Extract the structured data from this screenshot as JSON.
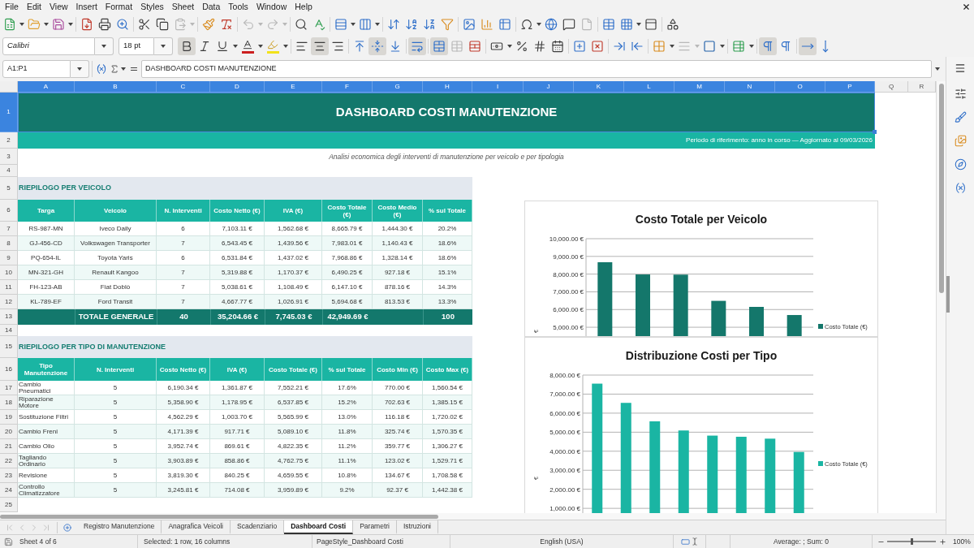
{
  "menu": [
    "File",
    "Edit",
    "View",
    "Insert",
    "Format",
    "Styles",
    "Sheet",
    "Data",
    "Tools",
    "Window",
    "Help"
  ],
  "standard_toolbar": [
    {
      "kind": "new",
      "disabled": false
    },
    {
      "kind": "open",
      "disabled": false
    },
    {
      "kind": "save",
      "disabled": false
    },
    {
      "kind": "export-pdf",
      "disabled": false
    },
    {
      "kind": "print",
      "disabled": false
    },
    {
      "kind": "print-preview",
      "disabled": false
    },
    {
      "kind": "cut",
      "disabled": false
    },
    {
      "kind": "copy",
      "disabled": false
    },
    {
      "kind": "paste",
      "disabled": true
    },
    {
      "kind": "clone-formatting",
      "disabled": false
    },
    {
      "kind": "clear-formatting",
      "disabled": false
    },
    {
      "kind": "undo",
      "disabled": true
    },
    {
      "kind": "redo",
      "disabled": true
    },
    {
      "kind": "find-replace",
      "disabled": false
    },
    {
      "kind": "spelling",
      "disabled": false
    },
    {
      "kind": "row",
      "disabled": false
    },
    {
      "kind": "column",
      "disabled": false
    },
    {
      "kind": "sort",
      "disabled": false
    },
    {
      "kind": "sort-ascending",
      "disabled": false
    },
    {
      "kind": "sort-descending",
      "disabled": false
    },
    {
      "kind": "autofilter",
      "disabled": false
    },
    {
      "kind": "image",
      "disabled": false
    },
    {
      "kind": "chart",
      "disabled": false
    },
    {
      "kind": "pivot-table",
      "disabled": false
    },
    {
      "kind": "special-character",
      "disabled": false
    },
    {
      "kind": "hyperlink",
      "disabled": false
    },
    {
      "kind": "comment",
      "disabled": false
    },
    {
      "kind": "header-footer",
      "disabled": true
    },
    {
      "kind": "print-area",
      "disabled": false
    },
    {
      "kind": "freeze",
      "disabled": false
    },
    {
      "kind": "split-window",
      "disabled": false
    },
    {
      "kind": "draw-functions",
      "disabled": false
    }
  ],
  "formatting_toolbar": {
    "font_name": "Calibri",
    "font_size": "18 pt",
    "buttons": [
      {
        "kind": "bold",
        "selected": true,
        "disabled": false
      },
      {
        "kind": "italic",
        "selected": false,
        "disabled": false
      },
      {
        "kind": "underline",
        "selected": false,
        "disabled": false
      },
      {
        "kind": "font-color",
        "selected": false,
        "disabled": false
      },
      {
        "kind": "highlight",
        "selected": false,
        "disabled": false
      },
      {
        "kind": "align-left",
        "selected": false,
        "disabled": false
      },
      {
        "kind": "align-center",
        "selected": true,
        "disabled": false
      },
      {
        "kind": "align-right",
        "selected": false,
        "disabled": false
      },
      {
        "kind": "align-top",
        "selected": false,
        "disabled": false
      },
      {
        "kind": "align-middle",
        "selected": true,
        "disabled": false
      },
      {
        "kind": "align-bottom",
        "selected": false,
        "disabled": false
      },
      {
        "kind": "wrap-text",
        "selected": true,
        "disabled": false
      },
      {
        "kind": "merge-center",
        "selected": true,
        "disabled": false
      },
      {
        "kind": "merge",
        "selected": false,
        "disabled": true
      },
      {
        "kind": "unmerge",
        "selected": false,
        "disabled": false
      },
      {
        "kind": "currency",
        "selected": false,
        "disabled": false
      },
      {
        "kind": "percent",
        "selected": false,
        "disabled": false
      },
      {
        "kind": "number",
        "selected": false,
        "disabled": false
      },
      {
        "kind": "date",
        "selected": false,
        "disabled": false
      },
      {
        "kind": "add-decimal",
        "selected": false,
        "disabled": false
      },
      {
        "kind": "delete-decimal",
        "selected": false,
        "disabled": false
      },
      {
        "kind": "indent",
        "selected": false,
        "disabled": false
      },
      {
        "kind": "outdent",
        "selected": false,
        "disabled": false
      },
      {
        "kind": "borders",
        "selected": false,
        "disabled": false
      },
      {
        "kind": "border-style",
        "selected": false,
        "disabled": true
      },
      {
        "kind": "border-color",
        "selected": false,
        "disabled": false
      },
      {
        "kind": "conditional",
        "selected": false,
        "disabled": false
      },
      {
        "kind": "ltr",
        "selected": true,
        "disabled": false
      },
      {
        "kind": "rtl",
        "selected": false,
        "disabled": false
      },
      {
        "kind": "text-ltr",
        "selected": true,
        "disabled": false
      },
      {
        "kind": "text-ttb",
        "selected": false,
        "disabled": false
      }
    ]
  },
  "formula_bar": {
    "name_box": "A1:P1",
    "content": "DASHBOARD COSTI MANUTENZIONE"
  },
  "sheet": {
    "columns": [
      {
        "label": "A",
        "selected": true
      },
      {
        "label": "B",
        "selected": true
      },
      {
        "label": "C",
        "selected": true
      },
      {
        "label": "D",
        "selected": true
      },
      {
        "label": "E",
        "selected": true
      },
      {
        "label": "F",
        "selected": true
      },
      {
        "label": "G",
        "selected": true
      },
      {
        "label": "H",
        "selected": true
      },
      {
        "label": "I",
        "selected": true
      },
      {
        "label": "J",
        "selected": true
      },
      {
        "label": "K",
        "selected": true
      },
      {
        "label": "L",
        "selected": true
      },
      {
        "label": "M",
        "selected": true
      },
      {
        "label": "N",
        "selected": true
      },
      {
        "label": "O",
        "selected": true
      },
      {
        "label": "P",
        "selected": true
      },
      {
        "label": "Q",
        "selected": false
      },
      {
        "label": "R",
        "selected": false
      }
    ],
    "rows": [
      {
        "label": "1",
        "selected": true
      },
      {
        "label": "2",
        "selected": false
      },
      {
        "label": "3",
        "selected": false
      },
      {
        "label": "4",
        "selected": false
      },
      {
        "label": "5",
        "selected": false
      },
      {
        "label": "6",
        "selected": false
      },
      {
        "label": "7",
        "selected": false
      },
      {
        "label": "8",
        "selected": false
      },
      {
        "label": "9",
        "selected": false
      },
      {
        "label": "10",
        "selected": false
      },
      {
        "label": "11",
        "selected": false
      },
      {
        "label": "12",
        "selected": false
      },
      {
        "label": "13",
        "selected": false
      },
      {
        "label": "14",
        "selected": false
      },
      {
        "label": "15",
        "selected": false
      },
      {
        "label": "16",
        "selected": false
      },
      {
        "label": "17",
        "selected": false
      },
      {
        "label": "18",
        "selected": false
      },
      {
        "label": "19",
        "selected": false
      },
      {
        "label": "20",
        "selected": false
      },
      {
        "label": "21",
        "selected": false
      },
      {
        "label": "22",
        "selected": false
      },
      {
        "label": "23",
        "selected": false
      },
      {
        "label": "24",
        "selected": false
      },
      {
        "label": "25",
        "selected": false
      }
    ],
    "title": "DASHBOARD COSTI MANUTENZIONE",
    "period": "Periodo di riferimento: anno in corso — Aggiornato al 09/03/2026",
    "subtitle": "Analisi economica degli interventi di manutenzione per veicolo e per tipologia",
    "vehicle_table": {
      "heading": "RIEPILOGO PER VEICOLO",
      "columns": [
        "Targa",
        "Veicolo",
        "N. Interventi",
        "Costo Netto (€)",
        "IVA (€)",
        "Costo Totale (€)",
        "Costo Medio (€)",
        "% sul Totale"
      ],
      "rows": [
        [
          "RS-987-MN",
          "Iveco Daily",
          "6",
          "7,103.11 €",
          "1,562.68 €",
          "8,665.79 €",
          "1,444.30 €",
          "20.2%"
        ],
        [
          "GJ-456-CD",
          "Volkswagen Transporter",
          "7",
          "6,543.45 €",
          "1,439.56 €",
          "7,983.01 €",
          "1,140.43 €",
          "18.6%"
        ],
        [
          "PQ-654-IL",
          "Toyota Yaris",
          "6",
          "6,531.84 €",
          "1,437.02 €",
          "7,968.86 €",
          "1,328.14 €",
          "18.6%"
        ],
        [
          "MN-321-GH",
          "Renault Kangoo",
          "7",
          "5,319.88 €",
          "1,170.37 €",
          "6,490.25 €",
          "927.18 €",
          "15.1%"
        ],
        [
          "FH-123-AB",
          "Fiat Doblò",
          "7",
          "5,038.61 €",
          "1,108.49 €",
          "6,147.10 €",
          "878.16 €",
          "14.3%"
        ],
        [
          "KL-789-EF",
          "Ford Transit",
          "7",
          "4,667.77 €",
          "1,026.91 €",
          "5,694.68 €",
          "813.53 €",
          "13.3%"
        ]
      ],
      "total": {
        "label": "TOTALE GENERALE",
        "interventions": "40",
        "net": "35,204.66 €",
        "vat": "7,745.03 €",
        "total": "42,949.69 €",
        "percent": "100"
      }
    },
    "type_table": {
      "heading": "RIEPILOGO PER TIPO DI MANUTENZIONE",
      "columns": [
        "Tipo Manutenzione",
        "N. Interventi",
        "Costo Netto (€)",
        "IVA (€)",
        "Costo Totale (€)",
        "% sul Totale",
        "Costo Min (€)",
        "Costo Max (€)"
      ],
      "rows": [
        [
          "Cambio Pneumatici",
          "5",
          "6,190.34 €",
          "1,361.87 €",
          "7,552.21 €",
          "17.6%",
          "770.00 €",
          "1,560.54 €"
        ],
        [
          "Riparazione Motore",
          "5",
          "5,358.90 €",
          "1,178.95 €",
          "6,537.85 €",
          "15.2%",
          "702.63 €",
          "1,385.15 €"
        ],
        [
          "Sostituzione Filtri",
          "5",
          "4,562.29 €",
          "1,003.70 €",
          "5,565.99 €",
          "13.0%",
          "116.18 €",
          "1,720.02 €"
        ],
        [
          "Cambio Freni",
          "5",
          "4,171.39 €",
          "917.71 €",
          "5,089.10 €",
          "11.8%",
          "325.74 €",
          "1,570.35 €"
        ],
        [
          "Cambio Olio",
          "5",
          "3,952.74 €",
          "869.61 €",
          "4,822.35 €",
          "11.2%",
          "359.77 €",
          "1,306.27 €"
        ],
        [
          "Tagliando Ordinario",
          "5",
          "3,903.89 €",
          "858.86 €",
          "4,762.75 €",
          "11.1%",
          "123.02 €",
          "1,529.71 €"
        ],
        [
          "Revisione",
          "5",
          "3,819.30 €",
          "840.25 €",
          "4,659.55 €",
          "10.8%",
          "134.67 €",
          "1,708.58 €"
        ],
        [
          "Controllo Climatizzatore",
          "5",
          "3,245.81 €",
          "714.08 €",
          "3,959.89 €",
          "9.2%",
          "92.37 €",
          "1,442.38 €"
        ]
      ]
    }
  },
  "charts": [
    {
      "chart_data": {
        "type": "bar",
        "title": "Costo Totale per Veicolo",
        "ylabel": "€",
        "ylim": [
          4500,
          10000
        ],
        "yticks": [
          {
            "value": 5000,
            "label": "5,000.00 €"
          },
          {
            "value": 6000,
            "label": "6,000.00 €"
          },
          {
            "value": 7000,
            "label": "7,000.00 €"
          },
          {
            "value": 8000,
            "label": "8,000.00 €"
          },
          {
            "value": 9000,
            "label": "9,000.00 €"
          },
          {
            "value": 10000,
            "label": "10,000.00 €"
          }
        ],
        "grid": true,
        "series": [
          {
            "name": "Costo Totale (€)",
            "color": "#14776b",
            "values": [
              8670,
              7980,
              7970,
              6490,
              6150,
              5690
            ]
          }
        ]
      }
    },
    {
      "chart_data": {
        "type": "bar",
        "title": "Distribuzione Costi per Tipo",
        "ylabel": "€",
        "ylim": [
          750,
          8000
        ],
        "yticks": [
          {
            "value": 1000,
            "label": "1,000.00 €"
          },
          {
            "value": 2000,
            "label": "2,000.00 €"
          },
          {
            "value": 3000,
            "label": "3,000.00 €"
          },
          {
            "value": 4000,
            "label": "4,000.00 €"
          },
          {
            "value": 5000,
            "label": "5,000.00 €"
          },
          {
            "value": 6000,
            "label": "6,000.00 €"
          },
          {
            "value": 7000,
            "label": "7,000.00 €"
          },
          {
            "value": 8000,
            "label": "8,000.00 €"
          }
        ],
        "grid": true,
        "series": [
          {
            "name": "Costo Totale (€)",
            "color": "#1ab5a3",
            "values": [
              7550,
              6540,
              5570,
              5090,
              4820,
              4760,
              4660,
              3960
            ]
          }
        ]
      }
    }
  ],
  "sheet_tabs": {
    "nav_disabled": true,
    "tabs": [
      {
        "label": "Registro Manutenzione",
        "selected": false
      },
      {
        "label": "Anagrafica Veicoli",
        "selected": false
      },
      {
        "label": "Scadenziario",
        "selected": false
      },
      {
        "label": "Dashboard Costi",
        "selected": true
      },
      {
        "label": "Parametri",
        "selected": false
      },
      {
        "label": "Istruzioni",
        "selected": false
      }
    ]
  },
  "status_bar": {
    "sheet": "Sheet 4 of 6",
    "selection": "Selected: 1 row, 16 columns",
    "page_style": "PageStyle_Dashboard Costi",
    "language": "English (USA)",
    "summary": "Average: ; Sum: 0",
    "zoom": {
      "label": "100%",
      "level": 0.5
    }
  }
}
